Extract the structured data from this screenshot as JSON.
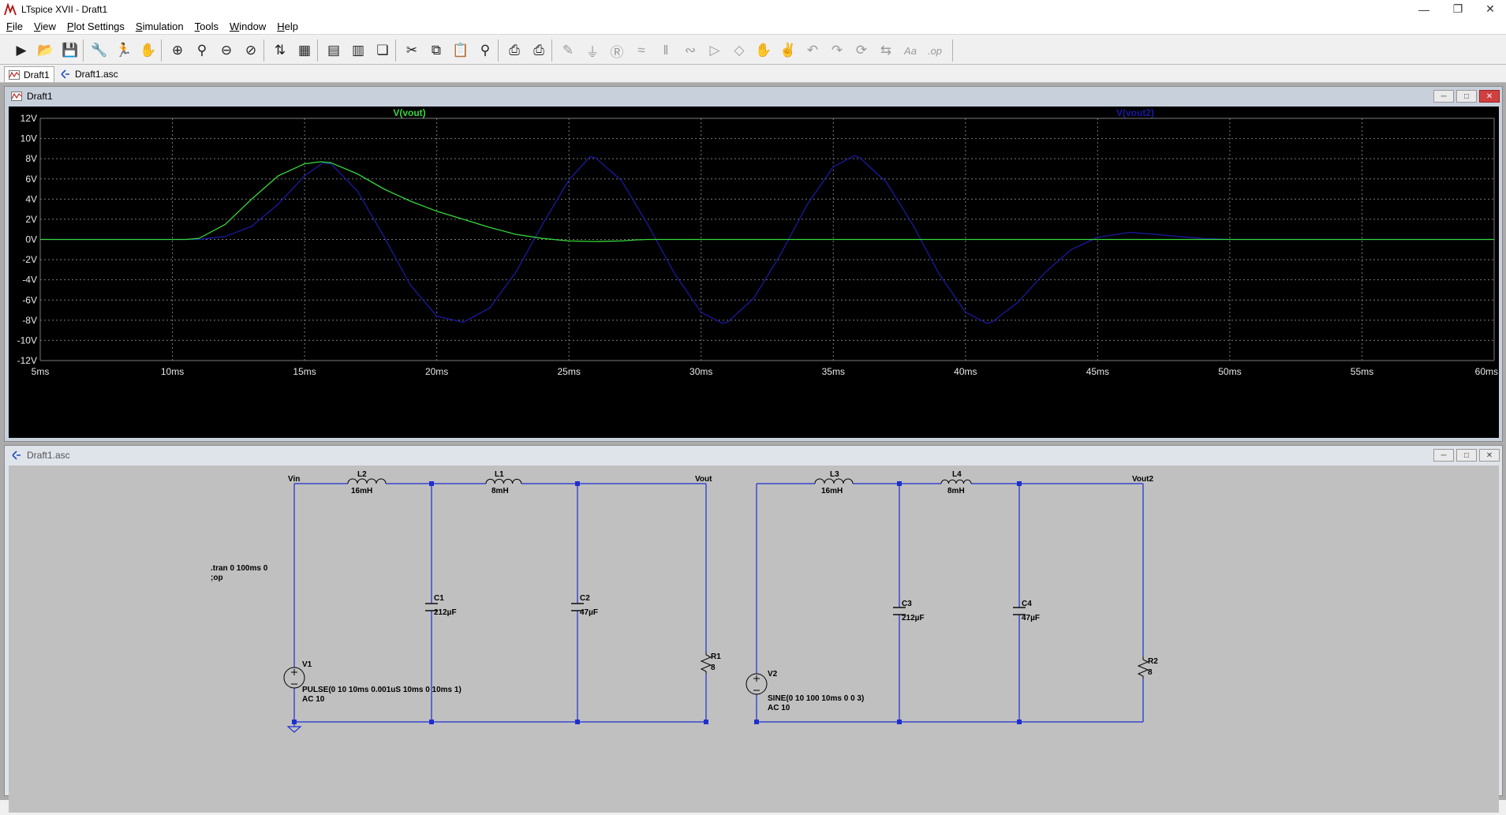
{
  "window": {
    "title": "LTspice XVII - Draft1"
  },
  "menu": [
    {
      "pre": "",
      "ul": "F",
      "post": "ile"
    },
    {
      "pre": "",
      "ul": "V",
      "post": "iew"
    },
    {
      "pre": "",
      "ul": "P",
      "post": "lot Settings"
    },
    {
      "pre": "",
      "ul": "S",
      "post": "imulation"
    },
    {
      "pre": "",
      "ul": "T",
      "post": "ools"
    },
    {
      "pre": "",
      "ul": "W",
      "post": "indow"
    },
    {
      "pre": "",
      "ul": "H",
      "post": "elp"
    }
  ],
  "toolbar": {
    "icons": [
      "run-icon",
      "open-icon",
      "save-icon",
      "control-panel-icon",
      "halt-icon",
      "pan-icon",
      "zoom-in-icon",
      "zoom-area-icon",
      "zoom-out-icon",
      "zoom-cancel-icon",
      "autorange-icon",
      "plot-settings-icon",
      "tile-horizontal-icon",
      "tile-vertical-icon",
      "cascade-icon",
      "cut-icon",
      "copy-icon",
      "paste-icon",
      "find-icon",
      "print-setup-icon",
      "print-icon",
      "wire-icon",
      "ground-icon",
      "label-icon",
      "resistor-icon",
      "capacitor-icon",
      "inductor-icon",
      "diode-icon",
      "component-icon",
      "move-icon",
      "drag-icon",
      "undo-icon",
      "redo-icon",
      "rotate-icon",
      "mirror-icon",
      "text-icon",
      "spice-directive-icon"
    ]
  },
  "tabs": [
    {
      "label": "Draft1",
      "icon": "waveform-icon"
    },
    {
      "label": "Draft1.asc",
      "icon": "schematic-icon"
    }
  ],
  "plot_window": {
    "title": "Draft1"
  },
  "schematic_window": {
    "title": "Draft1.asc"
  },
  "colors": {
    "trace1": "#36d83a",
    "trace2": "#1a1aa0",
    "plot_bg": "#000000",
    "grid": "#7a7a7a",
    "wire": "#1e2fd0",
    "schem_bg": "#c0c0c0"
  },
  "chart_data": {
    "type": "line",
    "series": [
      {
        "name": "V(vout)",
        "color": "#36d83a",
        "x": [
          5,
          10,
          10.5,
          11,
          12,
          13,
          14,
          15,
          15.6,
          16,
          17,
          18,
          19,
          20,
          21,
          22,
          23,
          24,
          25,
          26,
          27,
          27.5,
          28,
          29,
          30,
          35,
          40,
          45,
          47,
          49,
          50,
          51,
          52,
          53,
          60
        ],
        "y": [
          0,
          0,
          0,
          0.1,
          1.5,
          4,
          6.3,
          7.5,
          7.7,
          7.6,
          6.5,
          5,
          3.8,
          2.8,
          2,
          1.2,
          0.5,
          0.1,
          -0.15,
          -0.2,
          -0.15,
          -0.05,
          0,
          0,
          0,
          0,
          0,
          0,
          0,
          0,
          0,
          0,
          0,
          0,
          0
        ]
      },
      {
        "name": "V(vout2)",
        "color": "#1a1aa0",
        "x": [
          5,
          10,
          11,
          12,
          13,
          14,
          15,
          15.7,
          16,
          17,
          18,
          19,
          20,
          21,
          22,
          23,
          24,
          25,
          25.8,
          26,
          27,
          28,
          29,
          30,
          30.8,
          31,
          32,
          33,
          34,
          35,
          35.8,
          36,
          37,
          38,
          39,
          40,
          40.8,
          41,
          42,
          43,
          44,
          45,
          46.2,
          47,
          48,
          49,
          50,
          60
        ],
        "y": [
          0,
          0,
          0,
          0.3,
          1.3,
          3.5,
          6.3,
          7.6,
          7.5,
          4.8,
          0.3,
          -4.5,
          -7.6,
          -8.2,
          -6.8,
          -3.2,
          1.5,
          5.9,
          8.2,
          8.1,
          5.8,
          1.4,
          -3.4,
          -7.2,
          -8.3,
          -8.2,
          -5.8,
          -1.5,
          3.4,
          7.2,
          8.3,
          8.1,
          5.7,
          1.5,
          -3.4,
          -7.2,
          -8.3,
          -8.2,
          -6.2,
          -3.3,
          -1,
          0.2,
          0.7,
          0.55,
          0.3,
          0.1,
          0,
          0
        ]
      }
    ],
    "title": "",
    "xlabel": "",
    "ylabel": "",
    "xlim": [
      5,
      60
    ],
    "ylim": [
      -12,
      12
    ],
    "x_ticks": [
      "5ms",
      "10ms",
      "15ms",
      "20ms",
      "25ms",
      "30ms",
      "35ms",
      "40ms",
      "45ms",
      "50ms",
      "55ms",
      "60ms"
    ],
    "y_ticks": [
      "12V",
      "10V",
      "8V",
      "6V",
      "4V",
      "2V",
      "0V",
      "-2V",
      "-4V",
      "-6V",
      "-8V",
      "-10V",
      "-12V"
    ],
    "grid": true,
    "legend_placement": "top"
  },
  "schematic": {
    "nets": [
      "Vin",
      "Vout",
      "Vout2"
    ],
    "directive_lines": [
      ".tran 0 100ms 0",
      ";op"
    ],
    "components": [
      {
        "ref": "L2",
        "value": "16mH"
      },
      {
        "ref": "L1",
        "value": "8mH"
      },
      {
        "ref": "C1",
        "value": "212µF"
      },
      {
        "ref": "C2",
        "value": "47µF"
      },
      {
        "ref": "R1",
        "value": "8"
      },
      {
        "ref": "V1",
        "value_lines": [
          "PULSE(0 10 10ms 0.001uS 10ms 0 10ms 1)",
          "AC 10"
        ]
      },
      {
        "ref": "L3",
        "value": "16mH"
      },
      {
        "ref": "L4",
        "value": "8mH"
      },
      {
        "ref": "C3",
        "value": "212µF"
      },
      {
        "ref": "C4",
        "value": "47µF"
      },
      {
        "ref": "R2",
        "value": "8"
      },
      {
        "ref": "V2",
        "value_lines": [
          "SINE(0 10 100 10ms 0 0 3)",
          "AC 10"
        ]
      }
    ]
  }
}
